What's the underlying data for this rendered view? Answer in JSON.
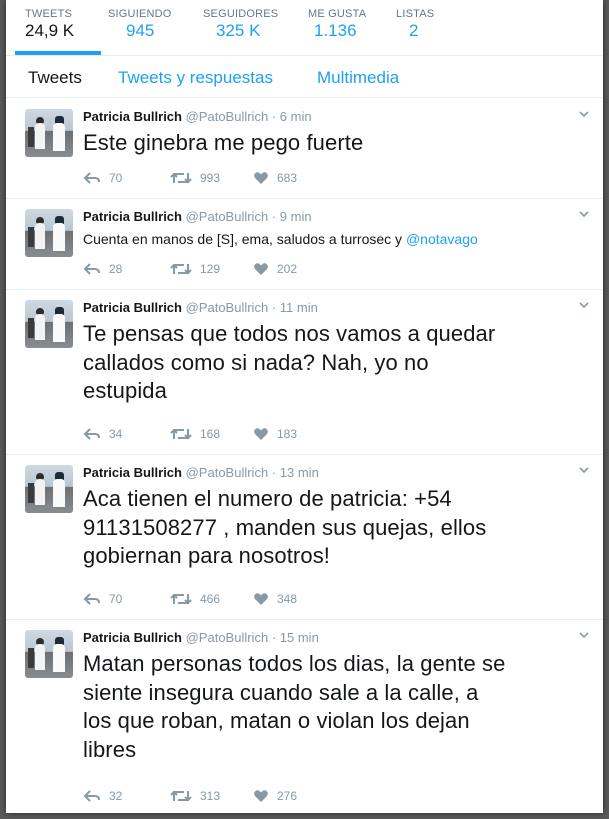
{
  "profile_stats": [
    {
      "label": "TWEETS",
      "value": "24,9 K"
    },
    {
      "label": "SIGUIENDO",
      "value": "945"
    },
    {
      "label": "SEGUIDORES",
      "value": "325 K"
    },
    {
      "label": "ME GUSTA",
      "value": "1.136"
    },
    {
      "label": "LISTAS",
      "value": "2"
    }
  ],
  "tabs": [
    "Tweets",
    "Tweets y respuestas",
    "Multimedia"
  ],
  "tweets": [
    {
      "name": "Patricia Bullrich",
      "handle": "@PatoBullrich",
      "separator": "·",
      "time": "6 min",
      "lines": [
        "Este ginebra me pego fuerte"
      ],
      "replies": "70",
      "retweets": "993",
      "likes": "683"
    },
    {
      "name": "Patricia Bullrich",
      "handle": "@PatoBullrich",
      "separator": "·",
      "time": "9 min",
      "text_before_link": "Cuenta en manos de [S], ema, saludos a turrosec y ",
      "link": "@notavago",
      "replies": "28",
      "retweets": "129",
      "likes": "202"
    },
    {
      "name": "Patricia Bullrich",
      "handle": "@PatoBullrich",
      "separator": "·",
      "time": "11 min",
      "lines": [
        "Te pensas que todos nos vamos a quedar",
        "callados como si nada? Nah, yo no",
        "estupida"
      ],
      "replies": "34",
      "retweets": "168",
      "likes": "183"
    },
    {
      "name": "Patricia Bullrich",
      "handle": "@PatoBullrich",
      "separator": "·",
      "time": "13 min",
      "lines": [
        "Aca tienen el numero de patricia: +54",
        "91131508277 , manden sus quejas, ellos",
        "gobiernan para nosotros!"
      ],
      "replies": "70",
      "retweets": "466",
      "likes": "348"
    },
    {
      "name": "Patricia Bullrich",
      "handle": "@PatoBullrich",
      "separator": "·",
      "time": "15 min",
      "lines": [
        "Matan personas todos los dias, la gente se",
        "siente insegura cuando sale a la calle, a",
        "los que roban, matan o violan los dejan",
        "libres"
      ],
      "replies": "32",
      "retweets": "313",
      "likes": "276"
    }
  ],
  "colors": {
    "accent": "#1da1f2",
    "muted": "#8899a6",
    "text": "#14171a"
  },
  "icons": [
    "reply-icon",
    "retweet-icon",
    "like-icon",
    "chevron-down-icon"
  ]
}
